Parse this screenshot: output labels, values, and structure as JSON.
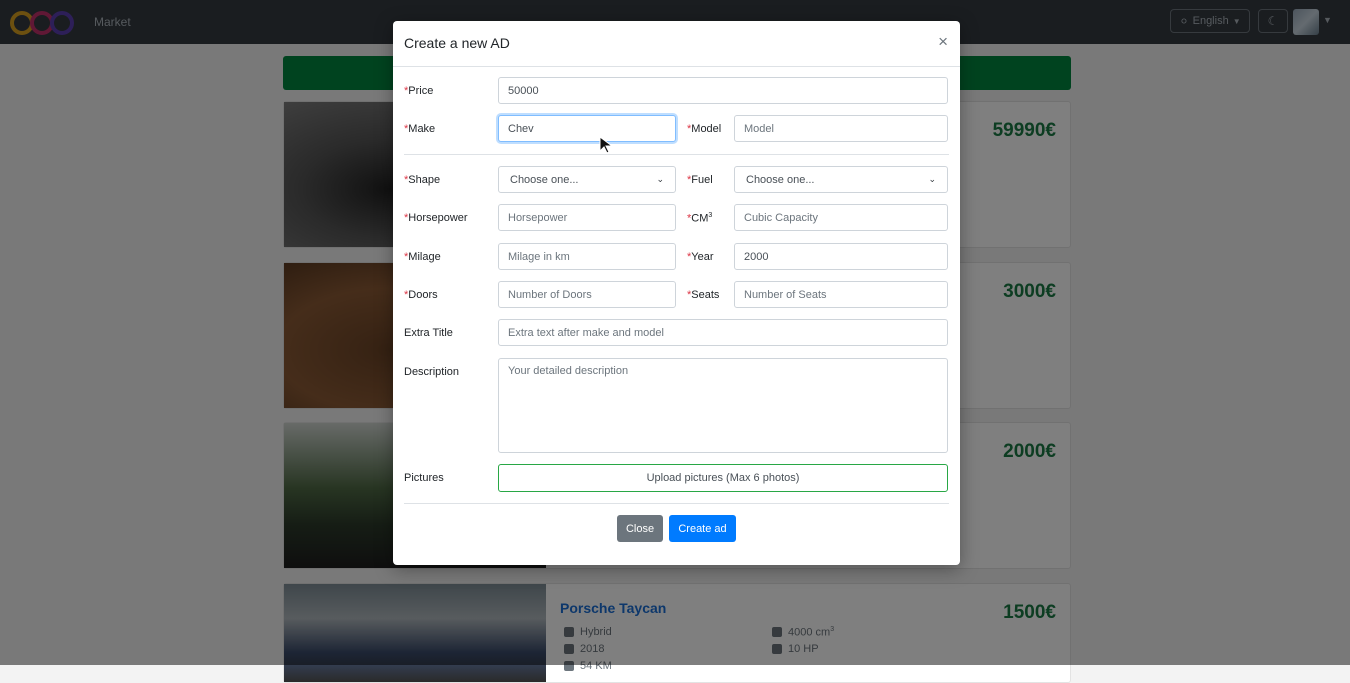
{
  "navbar": {
    "brand": "Market",
    "language": "English",
    "language_icon": "globe-icon",
    "theme_icon": "moon-icon"
  },
  "listings": [
    {
      "price": "59990€"
    },
    {
      "price": "3000€"
    },
    {
      "price": "2000€"
    },
    {
      "title": "Porsche Taycan",
      "price": "1500€",
      "fuel": "Hybrid",
      "year": "2018",
      "capacity": "4000 cm",
      "capacity_sup": "3",
      "power": "10 HP",
      "mileage": "54 KM"
    }
  ],
  "modal": {
    "title": "Create a new AD",
    "close_symbol": "×",
    "required_marker": "*",
    "price": {
      "label": "Price",
      "value": "50000"
    },
    "make": {
      "label": "Make",
      "value": "Chev"
    },
    "model": {
      "label": "Model",
      "placeholder": "Model"
    },
    "shape": {
      "label": "Shape",
      "selected": "Choose one..."
    },
    "fuel": {
      "label": "Fuel",
      "selected": "Choose one..."
    },
    "horsepower": {
      "label": "Horsepower",
      "placeholder": "Horsepower"
    },
    "cm": {
      "label": "CM",
      "sup": "3",
      "placeholder": "Cubic Capacity"
    },
    "milage": {
      "label": "Milage",
      "placeholder": "Milage in km"
    },
    "year": {
      "label": "Year",
      "value": "2000"
    },
    "doors": {
      "label": "Doors",
      "placeholder": "Number of Doors"
    },
    "seats": {
      "label": "Seats",
      "placeholder": "Number of Seats"
    },
    "extra_title": {
      "label": "Extra Title",
      "placeholder": "Extra text after make and model"
    },
    "description": {
      "label": "Description",
      "placeholder": "Your detailed description"
    },
    "pictures": {
      "label": "Pictures",
      "button": "Upload pictures (Max 6 photos)"
    },
    "buttons": {
      "close": "Close",
      "create": "Create ad"
    }
  },
  "colors": {
    "accent_green": "#00873e",
    "price_green": "#1b7a45",
    "primary": "#007bff",
    "secondary": "#6c757d",
    "required": "#dc3545"
  }
}
